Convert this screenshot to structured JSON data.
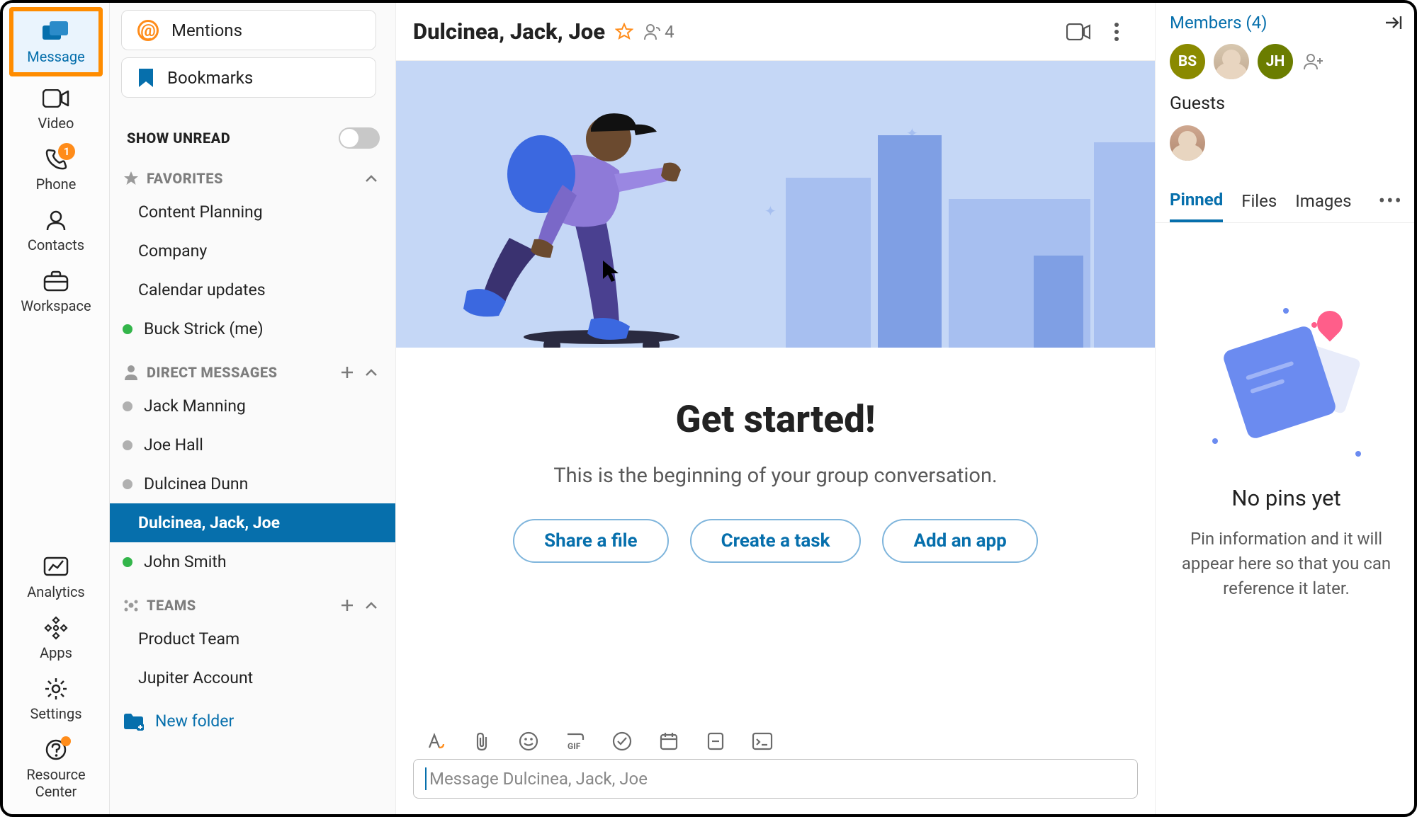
{
  "rail": {
    "items": [
      {
        "label": "Message",
        "icon": "message-icon",
        "active": true
      },
      {
        "label": "Video",
        "icon": "video-icon"
      },
      {
        "label": "Phone",
        "icon": "phone-icon",
        "badge": "1"
      },
      {
        "label": "Contacts",
        "icon": "contacts-icon"
      },
      {
        "label": "Workspace",
        "icon": "workspace-icon"
      }
    ],
    "bottom": [
      {
        "label": "Analytics",
        "icon": "analytics-icon"
      },
      {
        "label": "Apps",
        "icon": "apps-icon"
      },
      {
        "label": "Settings",
        "icon": "settings-icon"
      },
      {
        "label": "Resource Center",
        "icon": "help-icon",
        "dot": true
      }
    ]
  },
  "list": {
    "mentions": "Mentions",
    "bookmarks": "Bookmarks",
    "show_unread": "SHOW UNREAD",
    "sections": [
      {
        "name": "FAVORITES",
        "items": [
          {
            "name": "Content Planning"
          },
          {
            "name": "Company"
          },
          {
            "name": "Calendar updates"
          },
          {
            "name": "Buck Strick (me)",
            "status": "online"
          }
        ]
      },
      {
        "name": "DIRECT MESSAGES",
        "add": true,
        "items": [
          {
            "name": "Jack Manning",
            "status": "offline"
          },
          {
            "name": "Joe Hall",
            "status": "offline"
          },
          {
            "name": "Dulcinea Dunn",
            "status": "offline"
          },
          {
            "name": "Dulcinea, Jack, Joe",
            "selected": true
          },
          {
            "name": "John Smith",
            "status": "online"
          }
        ]
      },
      {
        "name": "TEAMS",
        "add": true,
        "items": [
          {
            "name": "Product Team"
          },
          {
            "name": "Jupiter Account"
          }
        ]
      }
    ],
    "new_folder": "New folder"
  },
  "header": {
    "title": "Dulcinea, Jack, Joe",
    "member_count": "4"
  },
  "welcome": {
    "title": "Get started!",
    "subtitle": "This is the beginning of your group conversation.",
    "actions": [
      "Share a file",
      "Create a task",
      "Add an app"
    ]
  },
  "composer": {
    "placeholder": "Message Dulcinea, Jack, Joe"
  },
  "right": {
    "members_link": "Members (4)",
    "avatars": [
      {
        "type": "initials",
        "text": "BS",
        "cls": "bs"
      },
      {
        "type": "photo"
      },
      {
        "type": "initials",
        "text": "JH",
        "cls": "jh"
      }
    ],
    "guests_label": "Guests",
    "tabs": [
      "Pinned",
      "Files",
      "Images"
    ],
    "empty": {
      "title": "No pins yet",
      "body": "Pin information and it will appear here so that you can reference it later."
    }
  }
}
